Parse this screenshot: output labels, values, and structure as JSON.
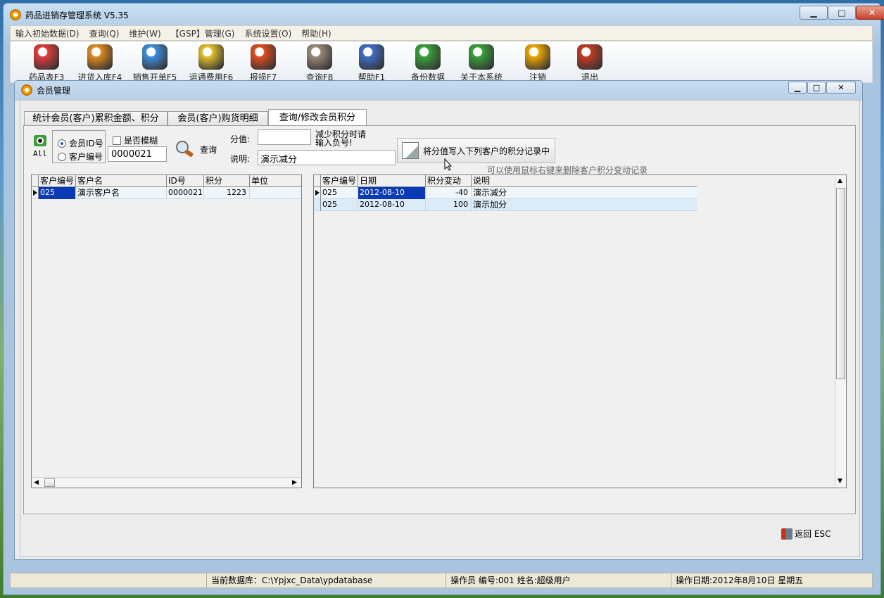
{
  "app": {
    "title": "药品进销存管理系统 V5.35"
  },
  "window_buttons": {
    "minimize": "▁",
    "maximize": "□",
    "close": "✕"
  },
  "menus": [
    "输入初始数据(D)",
    "查询(Q)",
    "维护(W)",
    "【GSP】管理(G)",
    "系统设置(O)",
    "帮助(H)"
  ],
  "toolbar": [
    {
      "label": "药品表F3",
      "icon": "drug-table-icon",
      "color": "#e23c3c"
    },
    {
      "label": "进货入库F4",
      "icon": "purchase-icon",
      "color": "#e38b1f"
    },
    {
      "label": "销售开单F5",
      "icon": "sales-icon",
      "color": "#3c8fe0"
    },
    {
      "label": "运通费用F6",
      "icon": "expense-icon",
      "color": "#e5c02a"
    },
    {
      "label": "报损F7",
      "icon": "loss-icon",
      "color": "#e04d1f"
    },
    {
      "label": "查询F8",
      "icon": "query-icon",
      "color": "#9a8a7a"
    },
    {
      "label": "帮助F1",
      "icon": "help-icon",
      "color": "#3f6fc8"
    },
    {
      "label": "备份数据",
      "icon": "backup-icon",
      "color": "#3aa13a"
    },
    {
      "label": "关于本系统",
      "icon": "about-icon",
      "color": "#3aa13a"
    },
    {
      "label": "注销",
      "icon": "logout-icon",
      "color": "#f0a800"
    },
    {
      "label": "退出",
      "icon": "exit-icon",
      "color": "#c23b22"
    }
  ],
  "child": {
    "title": "会员管理",
    "tabs": [
      "统计会员(客户)累积金额、积分",
      "会员(客户)购货明细",
      "查询/修改会员积分"
    ],
    "all_label": "All",
    "radio_member_id": "会员ID号",
    "radio_customer_no": "客户编号",
    "fuzzy_label": "是否模糊",
    "id_value": "0000021",
    "query_label": "查询",
    "score_label": "分值:",
    "score_value": "",
    "score_hint": "减少积分时请输入负号!",
    "desc_label": "说明:",
    "desc_value": "演示减分",
    "write_button": "将分值写入下列客户的积分记录中",
    "right_hint": "可以使用鼠标右键来删除客户积分变动记录",
    "return_label": "返回 ESC"
  },
  "left_grid": {
    "headers": [
      "客户编号",
      "客户名",
      "ID号",
      "积分",
      "单位"
    ],
    "rows": [
      [
        "025",
        "演示客户名",
        "0000021",
        "1223",
        ""
      ]
    ]
  },
  "right_grid": {
    "headers": [
      "客户编号",
      "日期",
      "积分变动",
      "说明"
    ],
    "rows": [
      [
        "025",
        "2012-08-10",
        "-40",
        "演示减分"
      ],
      [
        "025",
        "2012-08-10",
        "100",
        "演示加分"
      ]
    ]
  },
  "status": {
    "db": "当前数据库：C:\\Ypjxc_Data\\ypdatabase",
    "operator": "操作员 编号:001  姓名:超级用户",
    "date": "操作日期:2012年8月10日 星期五"
  }
}
